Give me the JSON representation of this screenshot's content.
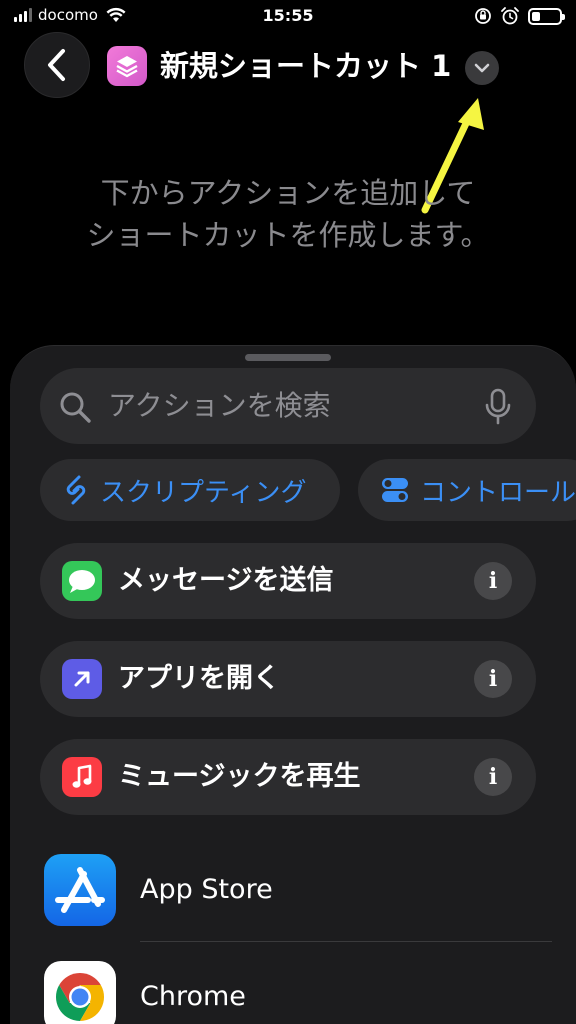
{
  "status_bar": {
    "carrier": "docomo",
    "time": "15:55"
  },
  "header": {
    "title": "新規ショートカット 1"
  },
  "empty_hint": {
    "line1": "下からアクションを追加して",
    "line2": "ショートカットを作成します。"
  },
  "sheet": {
    "search_placeholder": "アクションを検索",
    "chips": [
      {
        "label": "スクリプティング",
        "icon": "scripting-icon"
      },
      {
        "label": "コントロール",
        "icon": "toggle-icon"
      }
    ],
    "actions": [
      {
        "label": "メッセージを送信",
        "icon": "messages-icon",
        "color": "#34c759"
      },
      {
        "label": "アプリを開く",
        "icon": "open-app-arrow-icon",
        "color": "#5e5ce6"
      },
      {
        "label": "ミュージックを再生",
        "icon": "music-note-icon",
        "color": "#fc3c44"
      }
    ],
    "apps": [
      {
        "label": "App Store",
        "icon": "app-store-icon"
      },
      {
        "label": "Chrome",
        "icon": "chrome-icon"
      }
    ],
    "info_symbol": "i"
  },
  "colors": {
    "accent_blue": "#3b8ff5",
    "annotation_arrow": "#f5f542"
  }
}
